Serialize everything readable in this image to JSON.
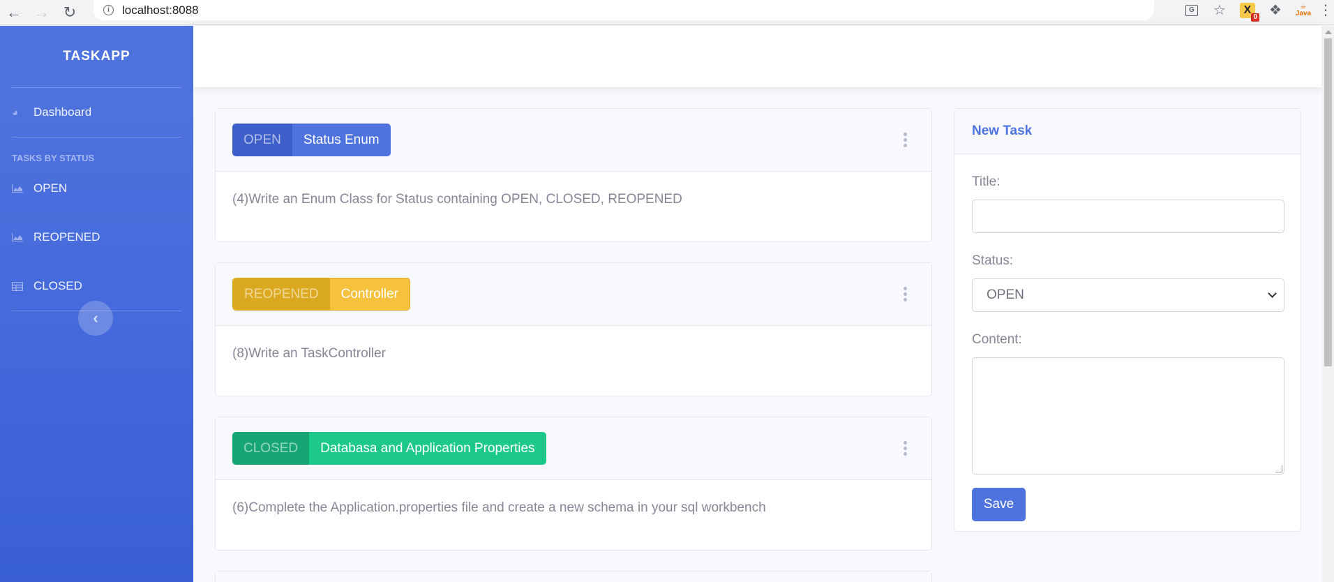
{
  "browser": {
    "url": "localhost:8088",
    "ext_badge": "0",
    "java_label": "Java"
  },
  "sidebar": {
    "brand": "TASKAPP",
    "dashboard_label": "Dashboard",
    "heading": "TASKS BY STATUS",
    "items": [
      {
        "label": "OPEN",
        "icon": "chart-area-icon"
      },
      {
        "label": "REOPENED",
        "icon": "chart-area-icon"
      },
      {
        "label": "CLOSED",
        "icon": "table-icon"
      }
    ]
  },
  "tasks": [
    {
      "status": "OPEN",
      "title": "Status Enum",
      "content": "(4)Write an Enum Class for Status containing OPEN, CLOSED, REOPENED"
    },
    {
      "status": "REOPENED",
      "title": "Controller",
      "content": "(8)Write an TaskController"
    },
    {
      "status": "CLOSED",
      "title": "Databasa and Application Properties",
      "content": "(6)Complete the Application.properties file and create a new schema in your sql workbench"
    }
  ],
  "form": {
    "header": "New Task",
    "title_label": "Title:",
    "title_value": "",
    "status_label": "Status:",
    "status_value": "OPEN",
    "content_label": "Content:",
    "content_value": "",
    "save_label": "Save"
  },
  "colors": {
    "primary": "#4e73df",
    "warning": "#f6c23e",
    "success": "#1cc88a"
  }
}
